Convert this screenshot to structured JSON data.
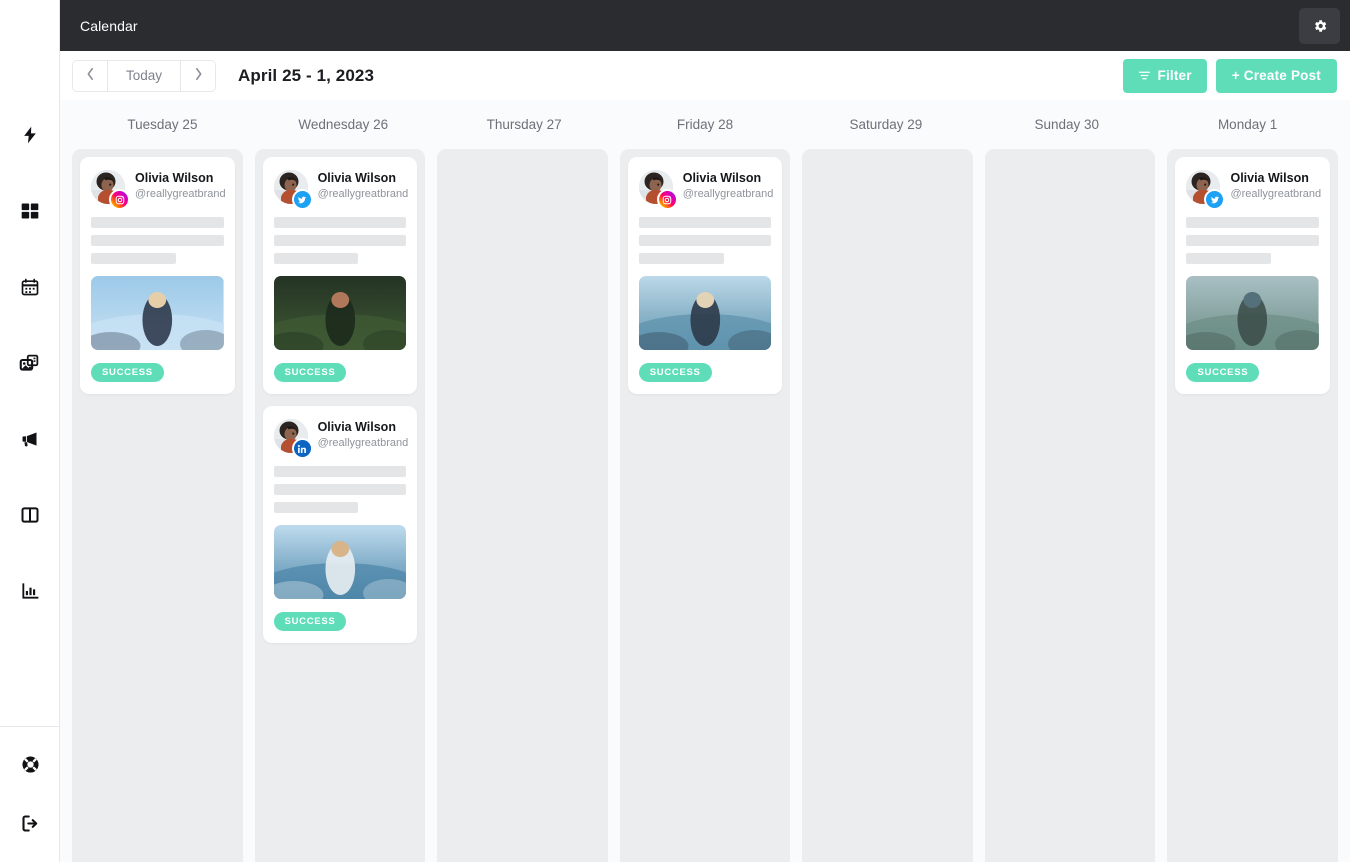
{
  "sidebar": {
    "top_items": [
      {
        "name": "lightning-icon",
        "label": "Quick actions"
      },
      {
        "name": "dashboard-grid-icon",
        "label": "Dashboard"
      },
      {
        "name": "calendar-icon",
        "label": "Calendar"
      },
      {
        "name": "media-library-icon",
        "label": "Media"
      },
      {
        "name": "megaphone-icon",
        "label": "Campaigns"
      },
      {
        "name": "columns-board-icon",
        "label": "Board"
      },
      {
        "name": "bar-chart-icon",
        "label": "Analytics"
      }
    ],
    "bottom_items": [
      {
        "name": "life-ring-icon",
        "label": "Support"
      },
      {
        "name": "logout-icon",
        "label": "Log out"
      }
    ]
  },
  "topbar": {
    "title": "Calendar",
    "settings_icon": "gear-icon"
  },
  "toolbar": {
    "prev_label": "‹",
    "today_label": "Today",
    "next_label": "›",
    "range_title": "April 25 - 1, 2023",
    "filter_label": "Filter",
    "filter_icon": "filter-icon",
    "create_post_label": "+ Create Post"
  },
  "colors": {
    "accent": "#5fddb9",
    "topbar_bg": "#2b2c30",
    "column_bg": "#ebedef",
    "calendar_bg": "#fafbfc"
  },
  "calendar": {
    "days": [
      {
        "header": "Tuesday 25"
      },
      {
        "header": "Wednesday 26"
      },
      {
        "header": "Thursday 27"
      },
      {
        "header": "Friday 28"
      },
      {
        "header": "Saturday 29"
      },
      {
        "header": "Sunday 30"
      },
      {
        "header": "Monday 1"
      }
    ],
    "posts": [
      {
        "day": "Tuesday 25",
        "author": "Olivia Wilson",
        "handle": "@reallygreatbrand",
        "network": "instagram",
        "status": "SUCCESS",
        "image_alt": "woman-in-sunglasses-against-blue-sky"
      },
      {
        "day": "Wednesday 26",
        "author": "Olivia Wilson",
        "handle": "@reallygreatbrand",
        "network": "twitter",
        "status": "SUCCESS",
        "image_alt": "woman-standing-by-jungle-waterfall"
      },
      {
        "day": "Wednesday 26",
        "author": "Olivia Wilson",
        "handle": "@reallygreatbrand",
        "network": "linkedin",
        "status": "SUCCESS",
        "image_alt": "man-leaning-off-sailboat-at-sea"
      },
      {
        "day": "Friday 28",
        "author": "Olivia Wilson",
        "handle": "@reallygreatbrand",
        "network": "instagram",
        "status": "SUCCESS",
        "image_alt": "woman-in-sunhat-facing-ocean"
      },
      {
        "day": "Monday 1",
        "author": "Olivia Wilson",
        "handle": "@reallygreatbrand",
        "network": "twitter",
        "status": "SUCCESS",
        "image_alt": "hiker-with-backpack-wading-in-lake"
      }
    ]
  }
}
